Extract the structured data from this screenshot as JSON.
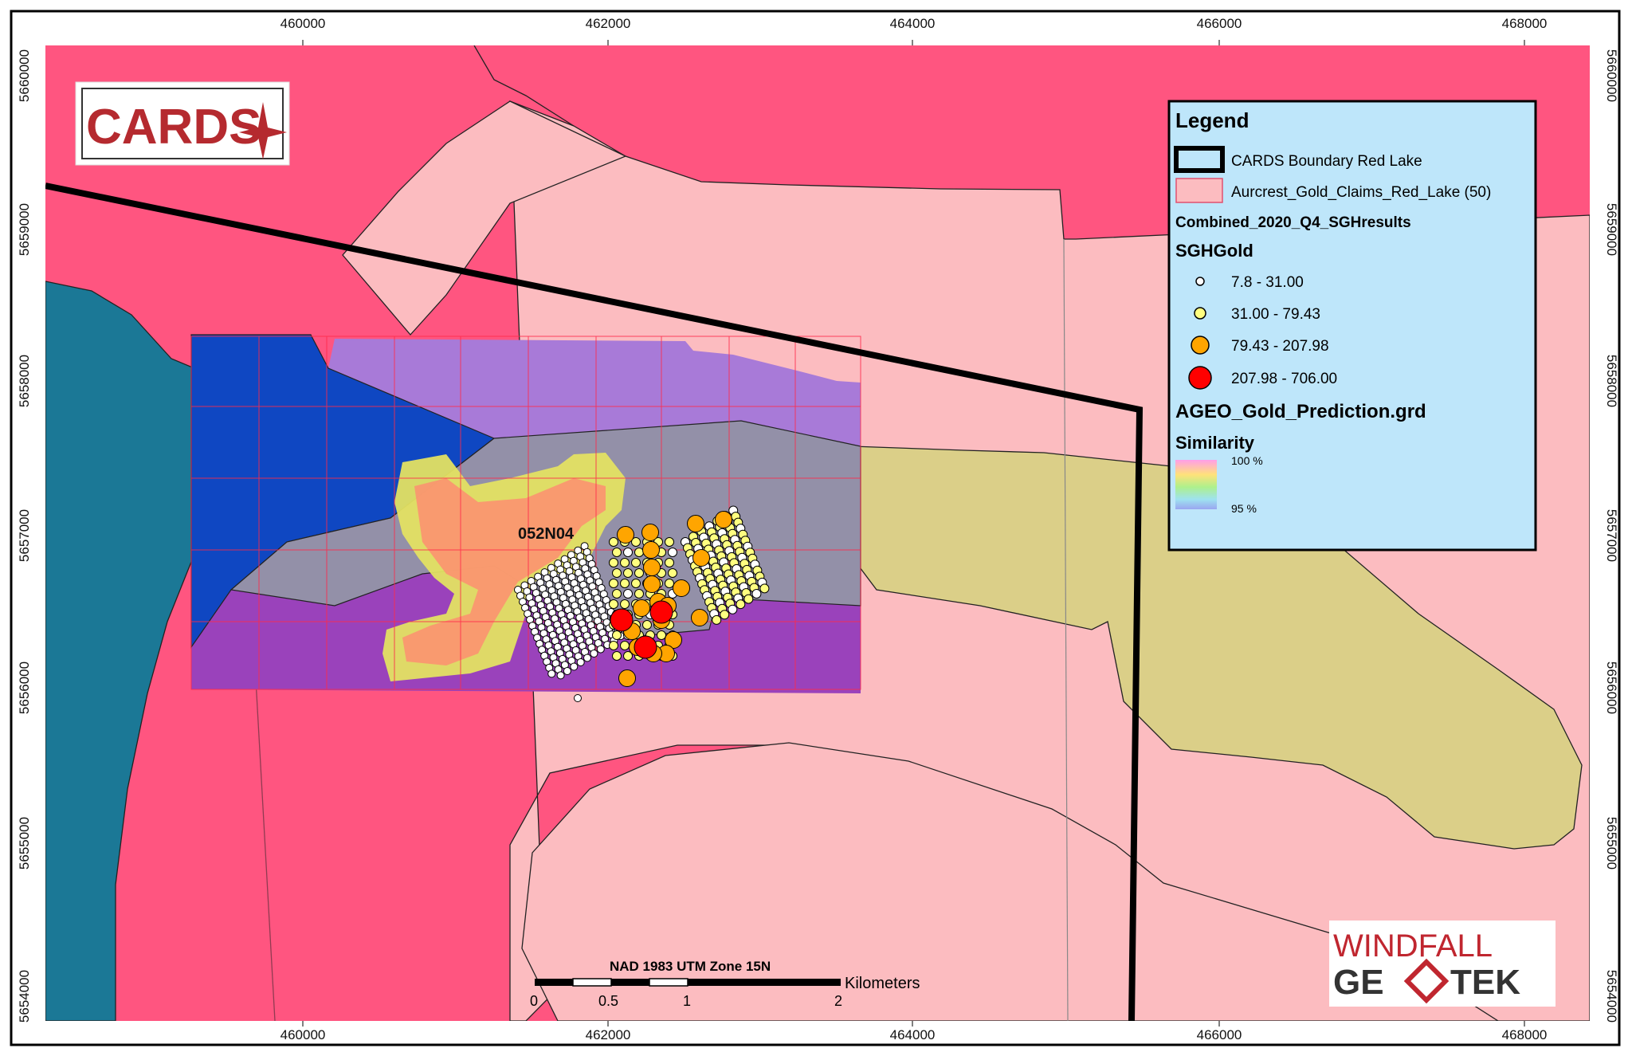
{
  "map": {
    "grid_label": "052N04",
    "x_ticks": [
      "460000",
      "462000",
      "464000",
      "466000",
      "468000"
    ],
    "y_ticks": [
      "5660000",
      "5659000",
      "5658000",
      "5657000",
      "5656000",
      "5655000",
      "5654000"
    ],
    "scalebar": {
      "title": "NAD 1983 UTM Zone 15N",
      "units": "Kilometers",
      "labels": [
        "0",
        "0.5",
        "1",
        "2"
      ]
    }
  },
  "legend": {
    "title": "Legend",
    "boundary_label": "CARDS Boundary Red Lake",
    "claims_label": "Aurcrest_Gold_Claims_Red_Lake (50)",
    "layer_label": "Combined_2020_Q4_SGHresults",
    "field_label": "SGHGold",
    "classes": [
      {
        "label": "7.8 - 31.00",
        "color": "#ffffff"
      },
      {
        "label": "31.00 - 79.43",
        "color": "#ffff80"
      },
      {
        "label": "79.43 - 207.98",
        "color": "#ffa500"
      },
      {
        "label": "207.98 - 706.00",
        "color": "#ff0000"
      }
    ],
    "raster_label": "AGEO_Gold_Prediction.grd",
    "similarity_label": "Similarity",
    "ramp_max": "100 %",
    "ramp_min": "95 %"
  },
  "logos": {
    "cards": "CARDS",
    "windfall_line1": "WINDFALL",
    "windfall_line2": "GE",
    "windfall_line3": "TEK"
  },
  "colors": {
    "claims_pink": "#ff5580",
    "light_pink": "#fcbcc0",
    "teal": "#1b7896",
    "khaki": "#dbcf88",
    "legend_bg": "#bee6fa"
  }
}
